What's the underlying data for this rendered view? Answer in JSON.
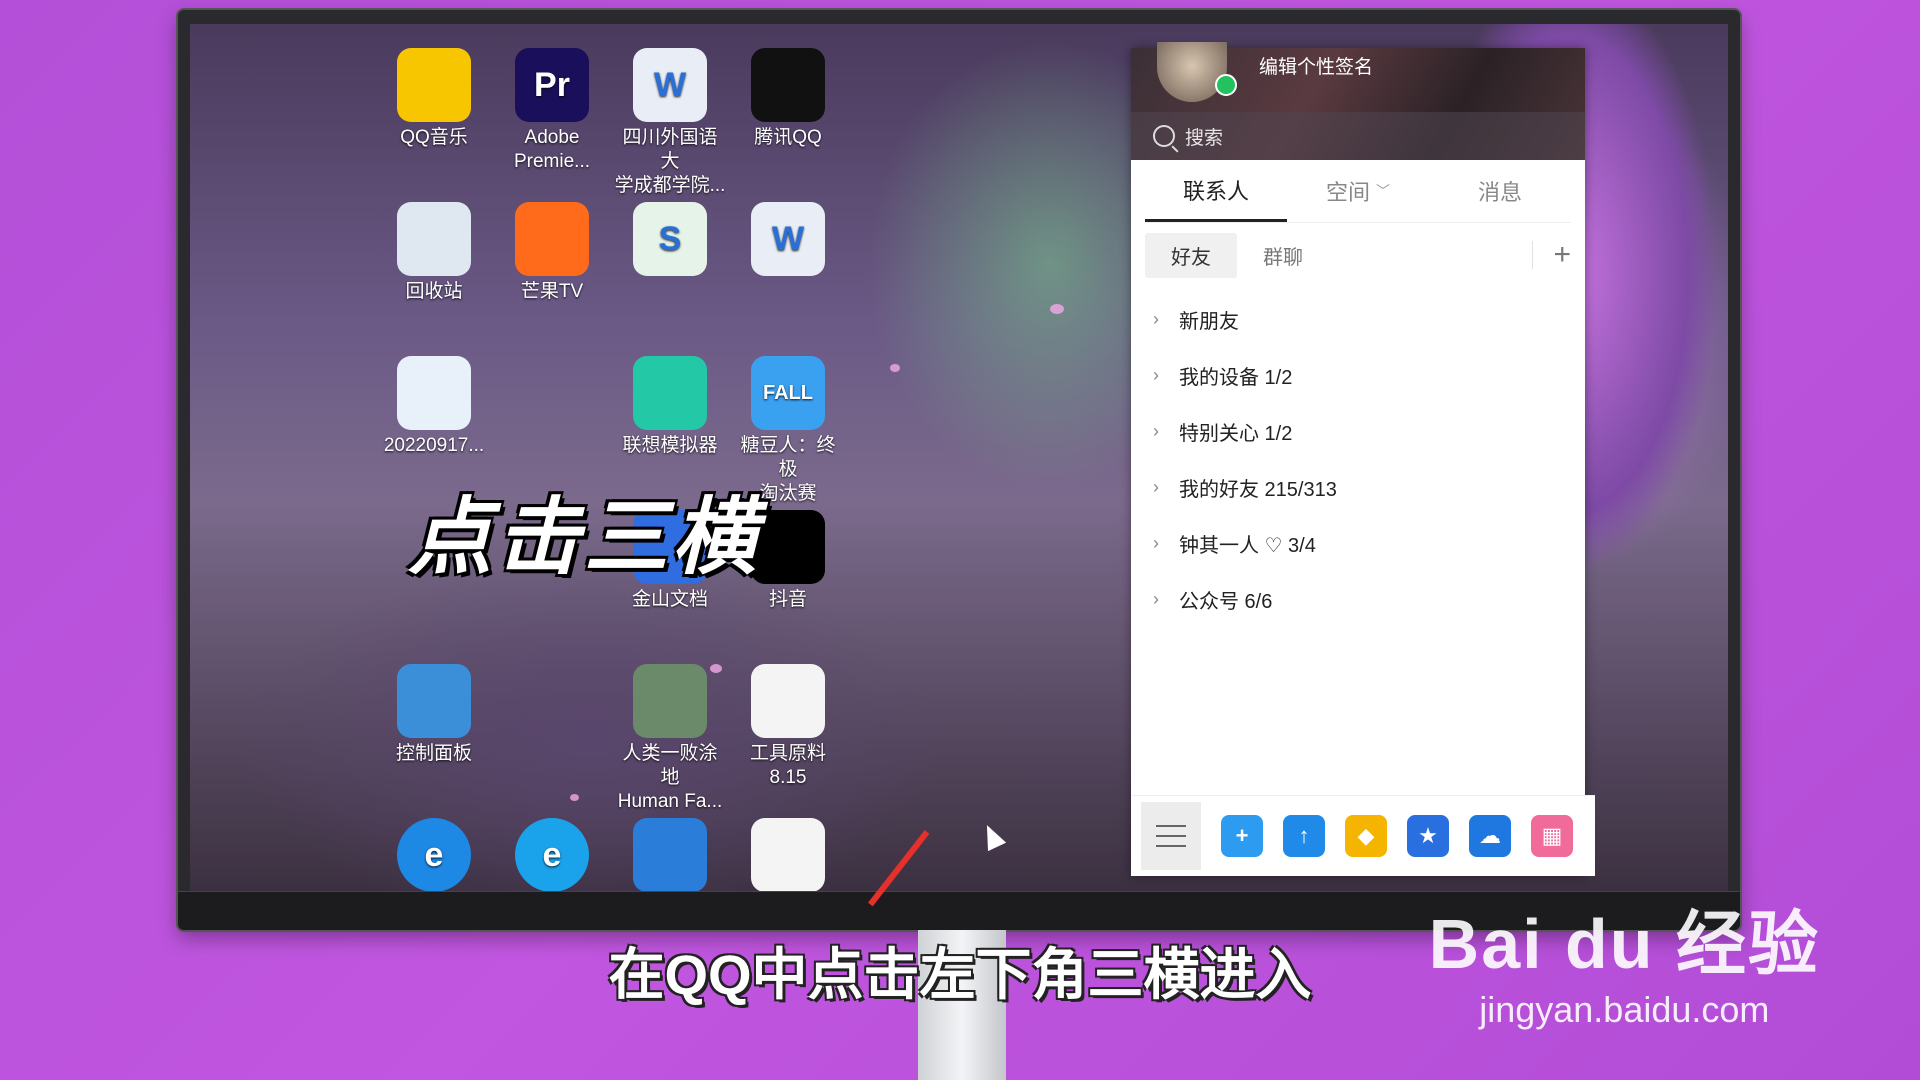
{
  "desktop_icons": [
    {
      "label": "QQ音乐",
      "icon": "qq-music-icon",
      "color": "#f7c600"
    },
    {
      "label": "Adobe\nPremie...",
      "icon": "premiere-icon",
      "color": "#1a0f5a",
      "glyph": "Pr"
    },
    {
      "label": "四川外国语大\n学成都学院...",
      "icon": "word-doc-icon",
      "color": "#e9edf5",
      "glyph": "W"
    },
    {
      "label": "腾讯QQ",
      "icon": "qq-penguin-icon",
      "color": "#111111"
    },
    {
      "label": "回收站",
      "icon": "recycle-bin-icon",
      "color": "#dfe8f0"
    },
    {
      "label": "芒果TV",
      "icon": "mango-tv-icon",
      "color": "#ff6b1a"
    },
    {
      "label": "",
      "icon": "spreadsheet-icon",
      "color": "#e5f3e8",
      "glyph": "S"
    },
    {
      "label": "",
      "icon": "word-doc-icon",
      "color": "#e9edf5",
      "glyph": "W"
    },
    {
      "label": "20220917...",
      "icon": "video-file-icon",
      "color": "#e8f0fa"
    },
    {
      "label": "联想模拟器",
      "icon": "lenovo-emulator-icon",
      "color": "#23c9a6"
    },
    {
      "label": "糖豆人：终极\n淘汰赛",
      "icon": "fall-guys-icon",
      "color": "#3aa0f0",
      "glyph": "FALL"
    },
    {
      "label": "金山文档",
      "icon": "kingsoft-docs-icon",
      "color": "#2f6de0"
    },
    {
      "label": "抖音",
      "icon": "douyin-icon",
      "color": "#000000"
    },
    {
      "label": "控制面板",
      "icon": "control-panel-icon",
      "color": "#3b8fd8"
    },
    {
      "label": "人类一败涂地\nHuman Fa...",
      "icon": "human-fall-flat-icon",
      "color": "#6b8a6a"
    },
    {
      "label": "工具原料\n8.15",
      "icon": "blank-file-icon",
      "color": "#f4f4f4"
    },
    {
      "label": "",
      "icon": "ie-icon",
      "color": "#1e88e5",
      "glyph": "e"
    },
    {
      "label": "",
      "icon": "edge-icon",
      "color": "#1aa3ea",
      "glyph": "e"
    },
    {
      "label": "",
      "icon": "settings-monitor-icon",
      "color": "#2a7dd8"
    },
    {
      "label": "",
      "icon": "blank-file-icon",
      "color": "#f4f4f4"
    }
  ],
  "overlay_title": "点击三横",
  "qq": {
    "signature": "编辑个性签名",
    "search_placeholder": "搜索",
    "tabs": [
      "联系人",
      "空间",
      "消息"
    ],
    "sub_tabs": [
      "好友",
      "群聊"
    ],
    "add_label": "+",
    "groups": [
      "新朋友",
      "我的设备 1/2",
      "特别关心 1/2",
      "我的好友 215/313",
      "钟其一人 ♡ 3/4",
      "公众号 6/6"
    ]
  },
  "caption": "在QQ中点击左下角三横进入",
  "watermark": {
    "logo": "Bai du 经验",
    "url": "jingyan.baidu.com"
  }
}
